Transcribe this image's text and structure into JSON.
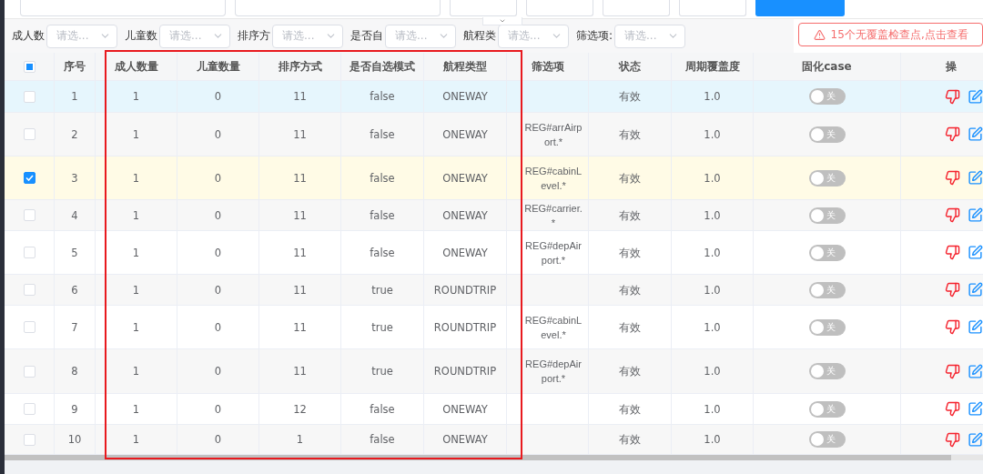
{
  "filters": [
    {
      "label": "成人数",
      "placeholder": "请选..."
    },
    {
      "label": "儿童数",
      "placeholder": "请选..."
    },
    {
      "label": "排序方",
      "placeholder": "请选..."
    },
    {
      "label": "是否自",
      "placeholder": "请选..."
    },
    {
      "label": "航程类",
      "placeholder": "请选..."
    },
    {
      "label": "筛选项:",
      "placeholder": "请选..."
    }
  ],
  "alert": {
    "text": "15个无覆盖检查点,点击查看"
  },
  "table": {
    "header_checkbox": {
      "indeterminate": true
    },
    "columns": [
      "序号",
      "成人数量",
      "儿童数量",
      "排序方式",
      "是否自选模式",
      "航程类型",
      "筛选项",
      "状态",
      "周期覆盖度",
      "固化case",
      "操"
    ],
    "rows": [
      {
        "checked": false,
        "hovered": true,
        "cells": [
          "1",
          "1",
          "0",
          "11",
          "false",
          "ONEWAY",
          "",
          "有效",
          "1.0"
        ],
        "switch": {
          "on": false,
          "label": "关"
        }
      },
      {
        "checked": false,
        "hovered": false,
        "cells": [
          "2",
          "1",
          "0",
          "11",
          "false",
          "ONEWAY",
          "REG#arrAirport.*",
          "有效",
          "1.0"
        ],
        "switch": {
          "on": false,
          "label": "关"
        }
      },
      {
        "checked": true,
        "hovered": false,
        "cells": [
          "3",
          "1",
          "0",
          "11",
          "false",
          "ONEWAY",
          "REG#cabinLevel.*",
          "有效",
          "1.0"
        ],
        "switch": {
          "on": false,
          "label": "关"
        }
      },
      {
        "checked": false,
        "hovered": false,
        "cells": [
          "4",
          "1",
          "0",
          "11",
          "false",
          "ONEWAY",
          "REG#carrier.*",
          "有效",
          "1.0"
        ],
        "switch": {
          "on": false,
          "label": "关"
        }
      },
      {
        "checked": false,
        "hovered": false,
        "cells": [
          "5",
          "1",
          "0",
          "11",
          "false",
          "ONEWAY",
          "REG#depAirport.*",
          "有效",
          "1.0"
        ],
        "switch": {
          "on": false,
          "label": "关"
        }
      },
      {
        "checked": false,
        "hovered": false,
        "cells": [
          "6",
          "1",
          "0",
          "11",
          "true",
          "ROUNDTRIP",
          "",
          "有效",
          "1.0"
        ],
        "switch": {
          "on": false,
          "label": "关"
        }
      },
      {
        "checked": false,
        "hovered": false,
        "cells": [
          "7",
          "1",
          "0",
          "11",
          "true",
          "ROUNDTRIP",
          "REG#cabinLevel.*",
          "有效",
          "1.0"
        ],
        "switch": {
          "on": false,
          "label": "关"
        }
      },
      {
        "checked": false,
        "hovered": false,
        "cells": [
          "8",
          "1",
          "0",
          "11",
          "true",
          "ROUNDTRIP",
          "REG#depAirport.*",
          "有效",
          "1.0"
        ],
        "switch": {
          "on": false,
          "label": "关"
        }
      },
      {
        "checked": false,
        "hovered": false,
        "cells": [
          "9",
          "1",
          "0",
          "12",
          "false",
          "ONEWAY",
          "",
          "有效",
          "1.0"
        ],
        "switch": {
          "on": false,
          "label": "关"
        }
      },
      {
        "checked": false,
        "hovered": false,
        "cells": [
          "10",
          "1",
          "0",
          "1",
          "false",
          "ONEWAY",
          "",
          "有效",
          "1.0"
        ],
        "switch": {
          "on": false,
          "label": "关"
        }
      }
    ]
  }
}
